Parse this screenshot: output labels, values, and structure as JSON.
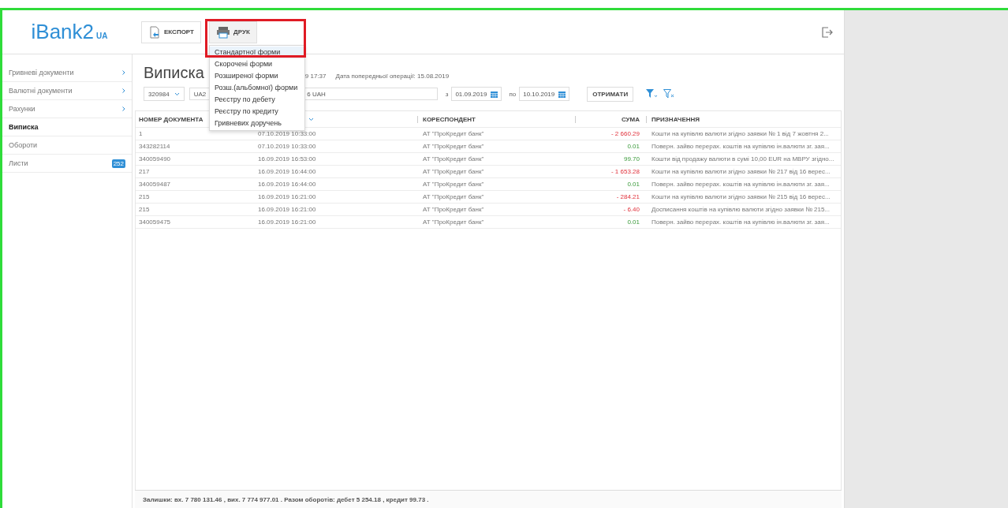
{
  "logo": {
    "name": "iBank2",
    "suffix": "UA"
  },
  "toolbar": {
    "buttons": [
      {
        "label": "ЕКСПОРТ",
        "kind": "export",
        "open": false
      },
      {
        "label": "ДРУК",
        "kind": "print",
        "open": true
      }
    ]
  },
  "print_menu": {
    "highlighted": true,
    "items": [
      {
        "label": "Стандартної форми",
        "selected": true
      },
      {
        "label": "Скорочені форми",
        "selected": false
      },
      {
        "label": "Розширеної форми",
        "selected": false
      },
      {
        "label": "Розш.(альбомної) форми",
        "selected": false
      },
      {
        "label": "Реєстру по дебету",
        "selected": false
      },
      {
        "label": "Реєстру по кредиту",
        "selected": false
      },
      {
        "label": "Гривневих доручень",
        "selected": false
      }
    ]
  },
  "sidebar": {
    "items": [
      {
        "label": "Гривневі документи",
        "selected": false,
        "expandable": true
      },
      {
        "label": "Валютні документи",
        "selected": false,
        "expandable": true
      },
      {
        "label": "Рахунки",
        "selected": false,
        "expandable": true
      },
      {
        "label": "Виписка",
        "selected": true,
        "expandable": false
      },
      {
        "label": "Обороти",
        "selected": false,
        "expandable": false
      },
      {
        "label": "Листи",
        "selected": false,
        "expandable": false,
        "badge": "252"
      }
    ]
  },
  "statement": {
    "title": "Виписка",
    "time_fragment": "9 17:37",
    "previous_operation": "Дата попередньої операції: 15.08.2019",
    "account_select": "320984",
    "account_start": "UA2",
    "account_end": "6 UAH",
    "from_label": "з",
    "date_from": "01.09.2019",
    "to_label": "по",
    "date_to": "10.10.2019",
    "get_button": "ОТРИМАТИ"
  },
  "table": {
    "columns": [
      "НОМЕР ДОКУМЕНТА",
      "КОРЕСПОНДЕНТ",
      "СУМА",
      "ПРИЗНАЧЕННЯ"
    ],
    "rows": [
      {
        "number": "1",
        "date": "07.10.2019 10:33:00",
        "correspondent": "АТ \"ПроКредит банк\"",
        "amount": "- 2 660.29",
        "kind": "debit",
        "purpose": "Кошти на купівлю валюти згідно заявки № 1 від 7 жовтня 2..."
      },
      {
        "number": "343282114",
        "date": "07.10.2019 10:33:00",
        "correspondent": "АТ \"ПроКредит банк\"",
        "amount": "0.01",
        "kind": "credit",
        "purpose": "Поверн. зайво перерах. коштів на купівлю ін.валюти зг. зая..."
      },
      {
        "number": "340059490",
        "date": "16.09.2019 16:53:00",
        "correspondent": "АТ \"ПроКредит банк\"",
        "amount": "99.70",
        "kind": "credit",
        "purpose": "Кошти від продажу валюти в сумі 10,00 EUR на МВРУ згідно..."
      },
      {
        "number": "217",
        "date": "16.09.2019 16:44:00",
        "correspondent": "АТ \"ПроКредит банк\"",
        "amount": "- 1 653.28",
        "kind": "debit",
        "purpose": "Кошти на купівлю валюти згідно заявки № 217 від 16 верес..."
      },
      {
        "number": "340059487",
        "date": "16.09.2019 16:44:00",
        "correspondent": "АТ \"ПроКредит банк\"",
        "amount": "0.01",
        "kind": "credit",
        "purpose": "Поверн. зайво перерах. коштів на купівлю ін.валюти зг. зая..."
      },
      {
        "number": "215",
        "date": "16.09.2019 16:21:00",
        "correspondent": "АТ \"ПроКредит банк\"",
        "amount": "- 284.21",
        "kind": "debit",
        "purpose": "Кошти на купівлю валюти згідно заявки № 215 від 16 верес..."
      },
      {
        "number": "215",
        "date": "16.09.2019 16:21:00",
        "correspondent": "АТ \"ПроКредит банк\"",
        "amount": "- 6.40",
        "kind": "debit",
        "purpose": "Досписання коштів на купівлю валюти згідно заявки № 215..."
      },
      {
        "number": "340059475",
        "date": "16.09.2019 16:21:00",
        "correspondent": "АТ \"ПроКредит банк\"",
        "amount": "0.01",
        "kind": "credit",
        "purpose": "Поверн. зайво перерах. коштів на купівлю ін.валюти зг. зая..."
      }
    ]
  },
  "footer": "Залишки: вх. 7 780 131.46 , вих. 7 774 977.01 . Разом оборотів: дебет 5 254.18 , кредит 99.73 ."
}
